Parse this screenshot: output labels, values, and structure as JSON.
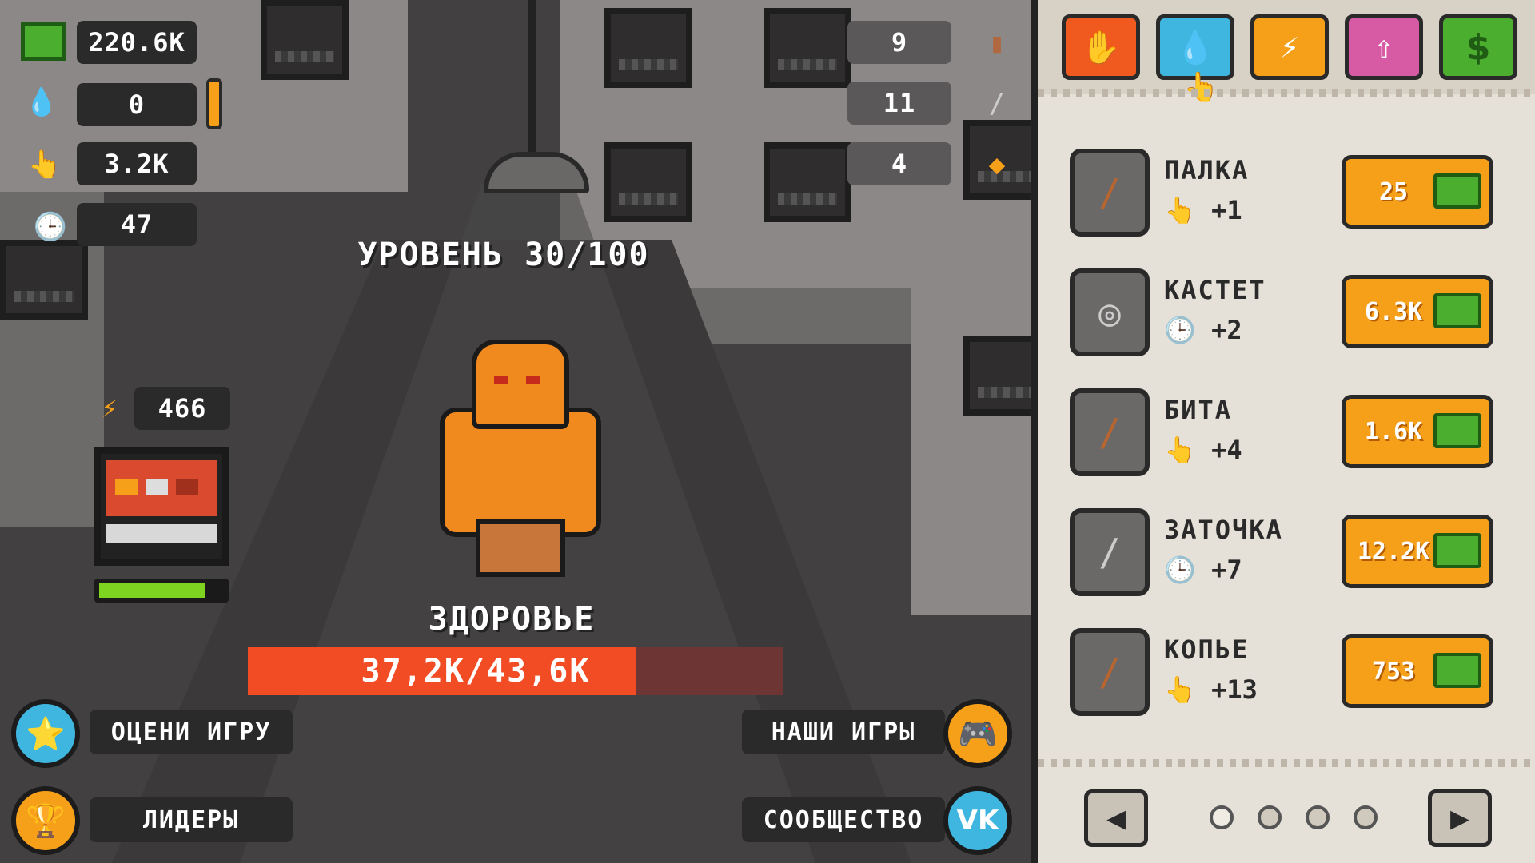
{
  "resources": {
    "cash": "220.6K",
    "drops": "0",
    "tap_power": "3.2K",
    "auto_power": "47",
    "energy": "466"
  },
  "right_counters": [
    "9",
    "11",
    "4"
  ],
  "level_text": "УРОВЕНЬ 30/100",
  "enemy": {
    "health_title": "ЗДОРОВЬЕ",
    "health_text": "37,2К/43,6К",
    "health_fraction": 0.853
  },
  "energy_fraction": 0.85,
  "bottom_buttons": {
    "rate": "ОЦЕНИ ИГРУ",
    "leaders": "ЛИДЕРЫ",
    "our_games": "НАШИ ИГРЫ",
    "community": "СООБЩЕСТВО"
  },
  "shop_tabs": [
    {
      "icon": "hand-icon",
      "color": "#f05a1e"
    },
    {
      "icon": "drop-icon",
      "color": "#3fb6e0"
    },
    {
      "icon": "lightning-icon",
      "color": "#f6a01a"
    },
    {
      "icon": "upgrade-arrow-icon",
      "color": "#d75aa5"
    },
    {
      "icon": "dollar-icon",
      "color": "#4cae2f"
    }
  ],
  "shop_items": [
    {
      "name": "ПАЛКА",
      "bonus": "+1",
      "price": "25",
      "icon": "stick-icon"
    },
    {
      "name": "КАСТЕТ",
      "bonus": "+2",
      "price": "6.3K",
      "icon": "brass-knuckles-icon"
    },
    {
      "name": "БИТА",
      "bonus": "+4",
      "price": "1.6K",
      "icon": "bat-icon"
    },
    {
      "name": "ЗАТОЧКА",
      "bonus": "+7",
      "price": "12.2K",
      "icon": "shiv-icon"
    },
    {
      "name": "КОПЬЕ",
      "bonus": "+13",
      "price": "753",
      "icon": "spear-icon"
    }
  ],
  "pagination": {
    "pages": 4,
    "current": 1
  },
  "colors": {
    "health_fill": "#f24c24",
    "health_bg": "#6e3535",
    "buy_button": "#f6a01a",
    "cash_green": "#4cae2f"
  }
}
